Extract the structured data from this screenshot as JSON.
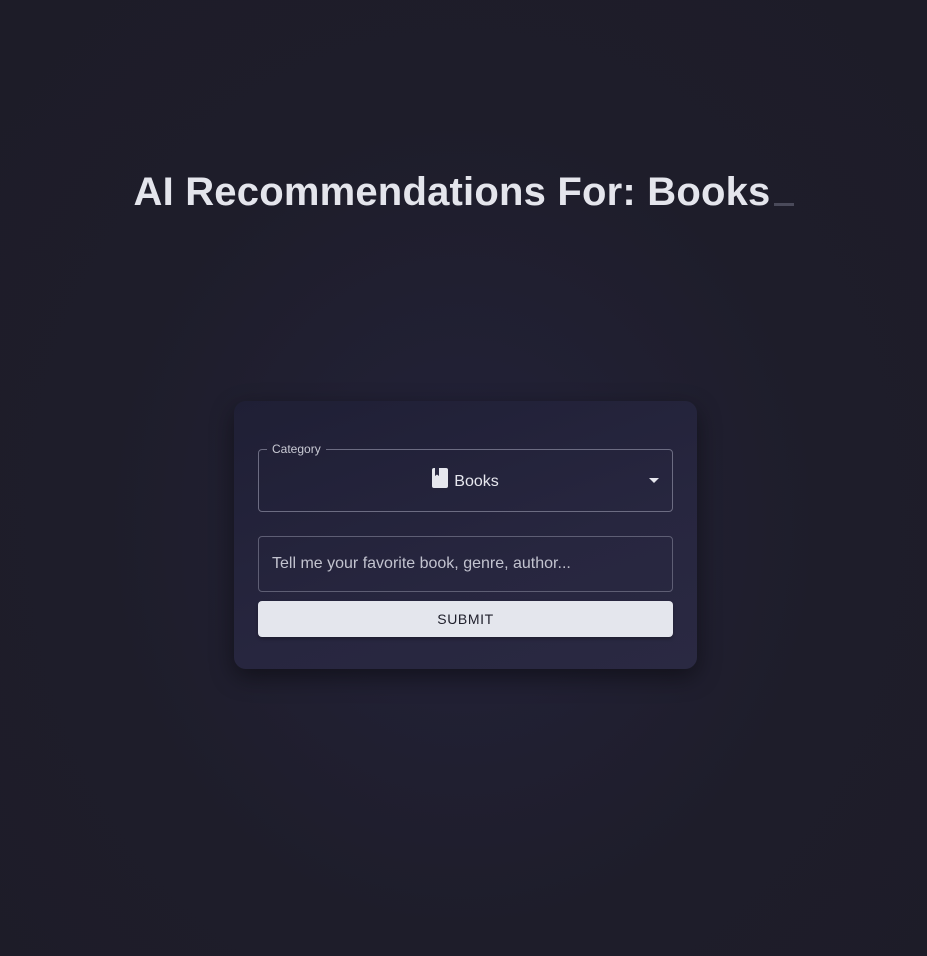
{
  "header": {
    "title": "AI Recommendations For: Books",
    "cursor_glyph": "_"
  },
  "form": {
    "category": {
      "legend": "Category",
      "selected_value": "Books",
      "selected_icon": "book-icon"
    },
    "query": {
      "value": "",
      "placeholder": "Tell me your favorite book, genre, author..."
    },
    "submit_label": "SUBMIT"
  },
  "colors": {
    "background": "#1e1d2a",
    "card": "#26253c",
    "button": "#e4e6ed",
    "text": "#e4e5ec"
  }
}
